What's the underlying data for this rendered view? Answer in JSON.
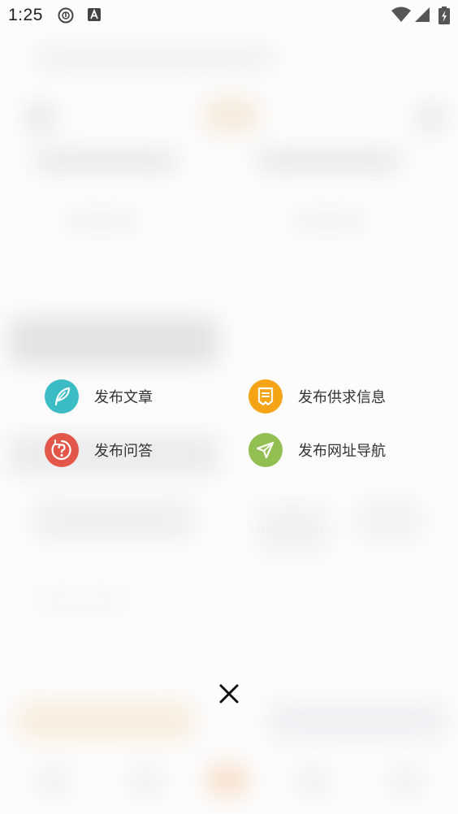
{
  "status_bar": {
    "time": "1:25",
    "left_icons": [
      "media-disc-icon",
      "app-a-icon"
    ],
    "right_icons": [
      "wifi-icon",
      "signal-icon",
      "battery-charging-icon"
    ]
  },
  "publish_menu": {
    "items": [
      {
        "label": "发布文章",
        "icon": "feather-icon",
        "color": "#3bbcc5"
      },
      {
        "label": "发布供求信息",
        "icon": "note-icon",
        "color": "#f5a416"
      },
      {
        "label": "发布问答",
        "icon": "question-icon",
        "color": "#e25749"
      },
      {
        "label": "发布网址导航",
        "icon": "paper-plane-icon",
        "color": "#93bf52"
      }
    ],
    "close_icon": "close-icon"
  }
}
